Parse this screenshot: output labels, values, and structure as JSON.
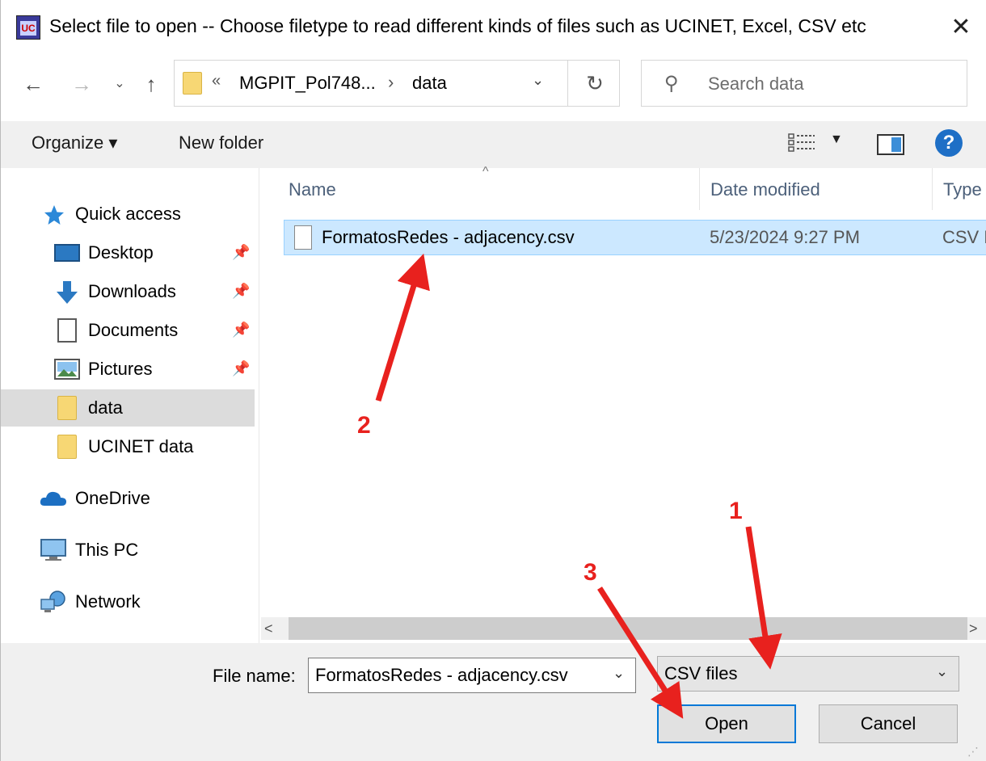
{
  "window": {
    "title": "Select file to open -- Choose filetype to read different kinds of files such as  UCINET, Excel, CSV etc",
    "app_icon_text": "UC",
    "close_glyph": "✕"
  },
  "nav": {
    "back_glyph": "←",
    "forward_glyph": "→",
    "recent_glyph": "⌄",
    "up_glyph": "↑",
    "address_chevron": "«",
    "address_parts": [
      "MGPIT_Pol748...",
      "data"
    ],
    "address_separator": "›",
    "address_dropdown_glyph": "⌄",
    "refresh_glyph": "↻",
    "search_placeholder": "Search data",
    "search_glyph": "⚲"
  },
  "toolbar": {
    "organize_label": "Organize ▾",
    "new_folder_label": "New folder",
    "view_dropdown_glyph": "▼",
    "help_glyph": "?"
  },
  "sidebar": {
    "pin_glyph": "📌",
    "items": [
      {
        "label": "Quick access",
        "icon": "star-icon"
      },
      {
        "label": "Desktop",
        "icon": "desktop-icon",
        "pinned": true
      },
      {
        "label": "Downloads",
        "icon": "download-icon",
        "pinned": true
      },
      {
        "label": "Documents",
        "icon": "documents-icon",
        "pinned": true
      },
      {
        "label": "Pictures",
        "icon": "pictures-icon",
        "pinned": true
      },
      {
        "label": "data",
        "icon": "folder-icon",
        "selected": true
      },
      {
        "label": "UCINET data",
        "icon": "folder-icon"
      },
      {
        "label": "OneDrive",
        "icon": "cloud-icon"
      },
      {
        "label": "This PC",
        "icon": "computer-icon"
      },
      {
        "label": "Network",
        "icon": "network-icon"
      }
    ]
  },
  "file_list": {
    "sort_glyph": "^",
    "columns": [
      "Name",
      "Date modified",
      "Type"
    ],
    "rows": [
      {
        "name": "FormatosRedes - adjacency.csv",
        "date": "5/23/2024 9:27 PM",
        "type": "CSV F",
        "selected": true
      }
    ]
  },
  "scrollbar": {
    "left_glyph": "<",
    "right_glyph": ">"
  },
  "bottom": {
    "file_name_label": "File name:",
    "file_name_value": "FormatosRedes - adjacency.csv",
    "file_type_value": "CSV files",
    "dropdown_glyph": "⌄",
    "open_label": "Open",
    "cancel_label": "Cancel",
    "grip_glyph": "⋰"
  },
  "annotations": {
    "color": "#e8211e",
    "labels": [
      "1",
      "2",
      "3"
    ]
  },
  "colors": {
    "selection_bg": "#cce8ff",
    "selection_border": "#99d1ff",
    "accent": "#0078d7"
  }
}
